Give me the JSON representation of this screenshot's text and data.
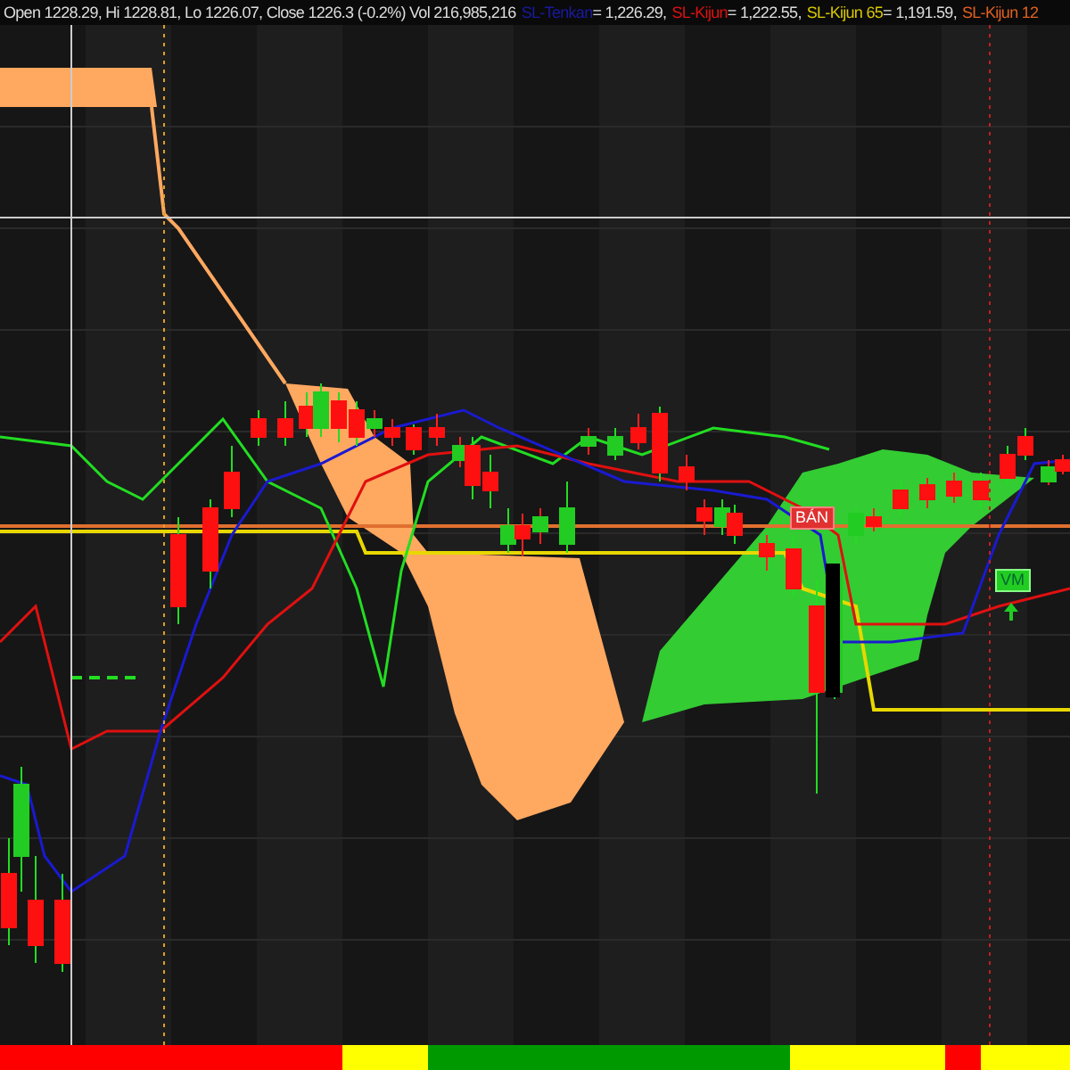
{
  "header": {
    "quote": "Open 1228.29, Hi 1228.81, Lo 1226.07, Close 1226.3 (-0.2%) Vol 216,985,216",
    "legend": [
      {
        "name": "SL-Tenkan",
        "value": " = 1,226.29,",
        "color": "#1a1aa0"
      },
      {
        "name": "SL-Kijun",
        "value": " = 1,222.55,",
        "color": "#e01010"
      },
      {
        "name": "SL-Kijun 65",
        "value": " = 1,191.59,",
        "color": "#d8c800"
      },
      {
        "name": "SL-Kijun 12",
        "color": "#e06020"
      }
    ]
  },
  "signals": [
    {
      "label": "BÁN",
      "kind": "sell"
    },
    {
      "label": "VM",
      "kind": "buy"
    }
  ],
  "status_strip": [
    {
      "color": "#ff0000"
    },
    {
      "color": "#ffff00"
    },
    {
      "color": "#009900"
    },
    {
      "color": "#ffff00"
    },
    {
      "color": "#ff0000"
    },
    {
      "color": "#ffff00"
    }
  ]
}
